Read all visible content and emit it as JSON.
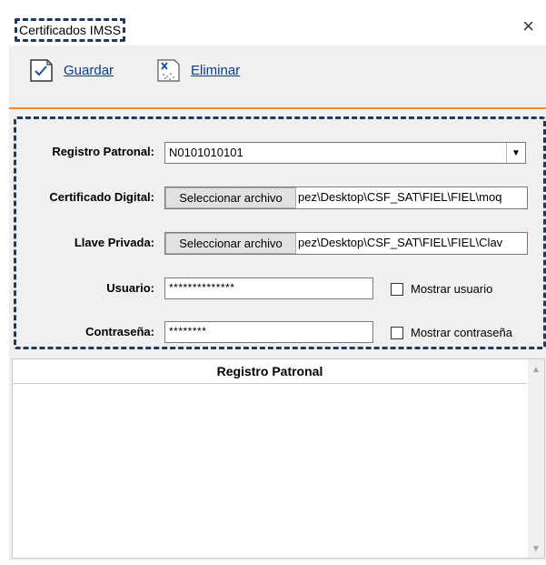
{
  "window": {
    "title": "Certificados IMSS",
    "close_glyph": "×"
  },
  "toolbar": {
    "save_label": "Guardar",
    "save_icon": "check-document-icon",
    "delete_label": "Eliminar",
    "delete_icon": "delete-document-icon"
  },
  "form": {
    "registro_label": "Registro Patronal:",
    "registro_value": "N0101010101",
    "certificado_label": "Certificado Digital:",
    "certificado_button": "Seleccionar archivo",
    "certificado_path": "pez\\Desktop\\CSF_SAT\\FIEL\\FIEL\\moq",
    "llave_label": "Llave Privada:",
    "llave_button": "Seleccionar archivo",
    "llave_path": "pez\\Desktop\\CSF_SAT\\FIEL\\FIEL\\Clav",
    "usuario_label": "Usuario:",
    "usuario_value": "**************",
    "mostrar_usuario": "Mostrar usuario",
    "contrasena_label": "Contraseña:",
    "contrasena_value": "********",
    "mostrar_contrasena": "Mostrar contraseña"
  },
  "grid": {
    "column_header": "Registro Patronal",
    "rows": []
  },
  "colors": {
    "accent_line": "#f08a30",
    "highlight_border": "#1f3b5c",
    "link": "#0a3d8f"
  }
}
